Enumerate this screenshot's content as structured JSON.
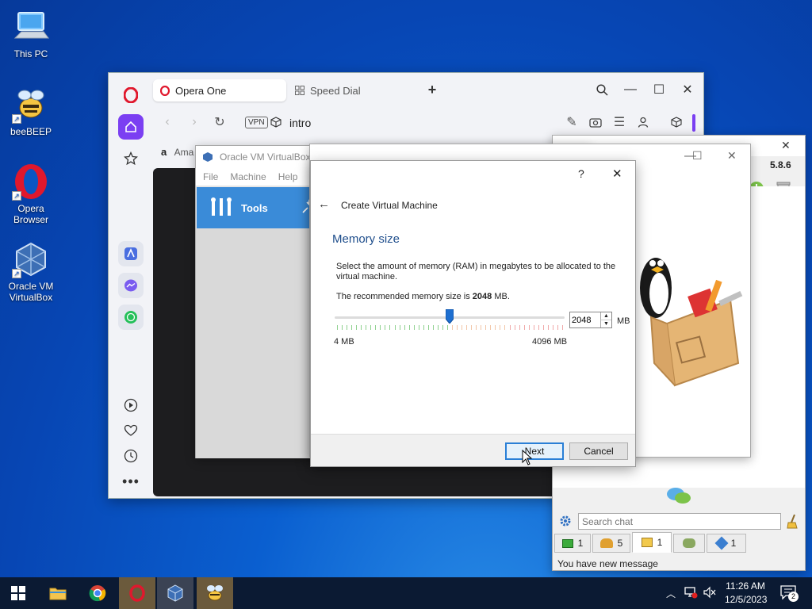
{
  "desktop": {
    "icons": [
      {
        "label": "This PC"
      },
      {
        "label": "beeBEEP"
      },
      {
        "label": "Opera\nBrowser",
        "line1": "Opera",
        "line2": "Browser"
      },
      {
        "label": "Oracle VM VirtualBox",
        "line1": "Oracle VM",
        "line2": "VirtualBox"
      }
    ]
  },
  "opera": {
    "tabs": [
      {
        "label": "Opera One"
      },
      {
        "label": "Speed Dial"
      }
    ],
    "vpn_badge": "VPN",
    "address": "intro",
    "bookmark_partial": "Ama"
  },
  "vbox_manager": {
    "title": "Oracle VM VirtualBox Manager",
    "menu": [
      "File",
      "Machine",
      "Help"
    ],
    "tools_label": "Tools"
  },
  "beebeep": {
    "title_partial": "...",
    "version": "5.8.6",
    "search_placeholder": "Search chat",
    "tabs": [
      {
        "count": "1"
      },
      {
        "count": "5"
      },
      {
        "count": "1"
      },
      {
        "count": ""
      },
      {
        "count": "1"
      }
    ],
    "status_message": "You have new message"
  },
  "dialog": {
    "help": "?",
    "close": "✕",
    "heading": "Create Virtual Machine",
    "section_title": "Memory size",
    "description": "Select the amount of memory (RAM) in megabytes to be allocated to the virtual machine.",
    "recommended_prefix": "The recommended memory size is",
    "recommended_value": "2048",
    "recommended_suffix": "MB.",
    "memory_value": "2048",
    "unit": "MB",
    "min_label": "4 MB",
    "max_label": "4096 MB",
    "slider_fraction": 0.5,
    "next_label": "Next",
    "cancel_label": "Cancel"
  },
  "taskbar": {
    "time": "11:26 AM",
    "date": "12/5/2023",
    "notification_count": "2"
  },
  "colors": {
    "accent_blue": "#3a8bd8",
    "opera_red": "#e0182d",
    "vbox_section_title": "#1f4e8c"
  }
}
